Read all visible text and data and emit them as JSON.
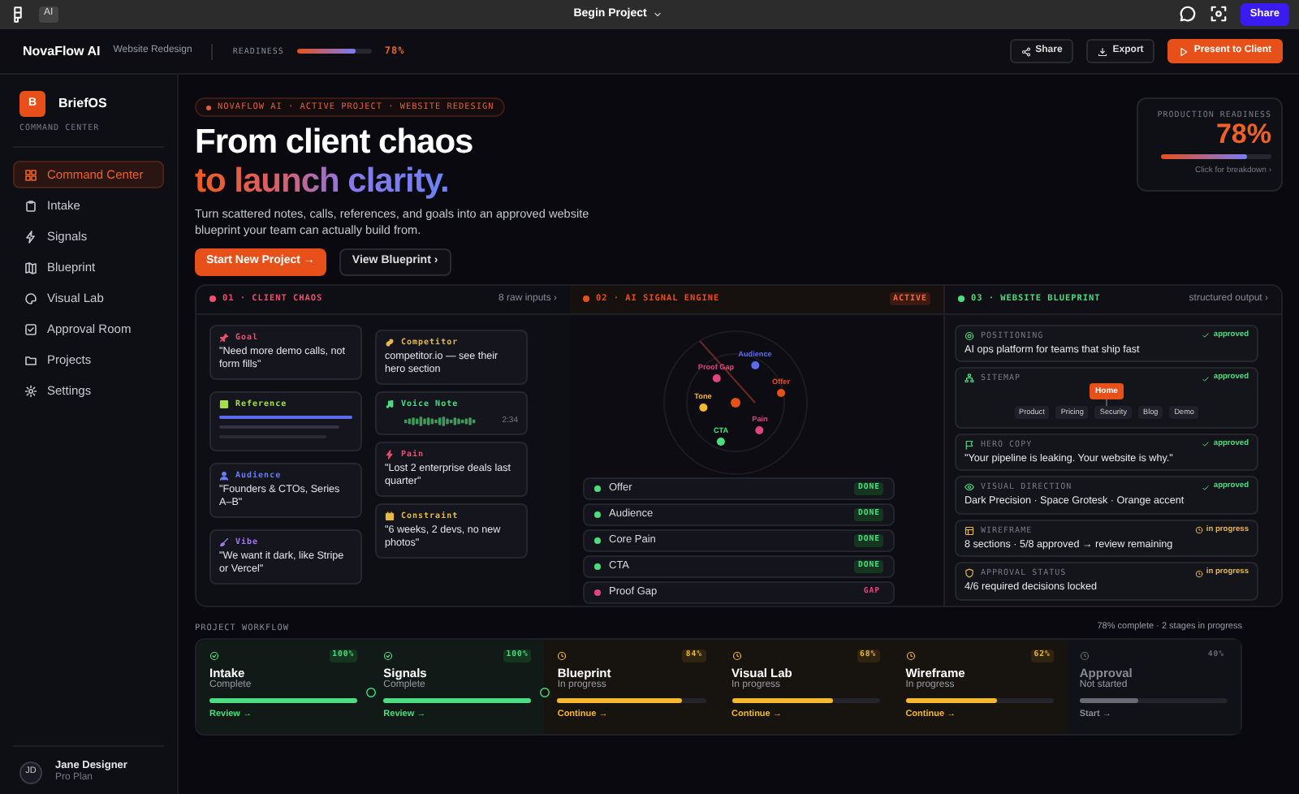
{
  "app_bar": {
    "badge": "AI",
    "file_title": "Begin Project",
    "share_button": "Share"
  },
  "header": {
    "brand": "NovaFlow AI",
    "project": "Website Redesign",
    "readiness_label": "READINESS",
    "readiness": {
      "level": 0.78,
      "reading": "78%"
    },
    "actions": [
      {
        "label": "Share",
        "kind": "share"
      },
      {
        "label": "Export",
        "kind": "export"
      },
      {
        "label": "Present to Client",
        "kind": "present"
      }
    ]
  },
  "sidebar": {
    "logo_letter": "B",
    "brand": "BriefOS",
    "subtitle": "COMMAND CENTER",
    "items": [
      {
        "label": "Command Center",
        "selected": true
      },
      {
        "label": "Intake",
        "selected": false
      },
      {
        "label": "Signals",
        "selected": false
      },
      {
        "label": "Blueprint",
        "selected": false
      },
      {
        "label": "Visual Lab",
        "selected": false
      },
      {
        "label": "Approval Room",
        "selected": false
      },
      {
        "label": "Projects",
        "selected": false
      },
      {
        "label": "Settings",
        "selected": false
      }
    ],
    "user": {
      "initials": "JD",
      "name": "Jane Designer",
      "plan": "Pro Plan"
    }
  },
  "hero": {
    "tag": "NOVAFLOW AI · ACTIVE PROJECT · WEBSITE REDESIGN",
    "headline_1": "From client chaos",
    "headline_2": "to launch clarity.",
    "lead": "Turn scattered notes, calls, references, and goals into an approved website blueprint your team can actually build from.",
    "primary_button": "Start New Project →",
    "secondary_button": "View Blueprint ›"
  },
  "readiness_card": {
    "label": "PRODUCTION READINESS",
    "value": "78%",
    "level": 0.78,
    "link": "Click for breakdown ›"
  },
  "client_chaos": {
    "title": "01 · CLIENT CHAOS",
    "count": "8 raw inputs ›",
    "columns": [
      {
        "cards": [
          {
            "kind": "text",
            "label": "Goal",
            "color": "#ef4f6e",
            "text": "\"Need more demo calls, not form fills\""
          },
          {
            "kind": "reference",
            "label": "Reference",
            "color": "#a3e04a"
          },
          {
            "kind": "text",
            "label": "Audience",
            "color": "#6b7cf5",
            "text": "\"Founders & CTOs, Series A–B\""
          },
          {
            "kind": "text",
            "label": "Vibe",
            "color": "#a678f0",
            "text": "\"We want it dark, like Stripe or Vercel\""
          }
        ]
      },
      {
        "cards": [
          {
            "kind": "text",
            "label": "Competitor",
            "color": "#e8b84a",
            "text": "competitor.io — see their hero section"
          },
          {
            "kind": "voice",
            "label": "Voice Note",
            "color": "#4ade80",
            "duration": "2:34"
          },
          {
            "kind": "text",
            "label": "Pain",
            "color": "#ef4f6e",
            "text": "\"Lost 2 enterprise deals last quarter\""
          },
          {
            "kind": "text",
            "label": "Constraint",
            "color": "#e8b84a",
            "text": "\"6 weeks, 2 devs, no new photos\""
          }
        ]
      }
    ]
  },
  "signal_engine": {
    "title": "02 · AI SIGNAL ENGINE",
    "status": "ACTIVE",
    "nodes": [
      {
        "label": "Audience",
        "color": "#5b6cf0"
      },
      {
        "label": "Proof Gap",
        "color": "#e0457b"
      },
      {
        "label": "Offer",
        "color": "#e8501a"
      },
      {
        "label": "Tone",
        "color": "#f5b82e"
      },
      {
        "label": "Pain",
        "color": "#e0457b"
      },
      {
        "label": "CTA",
        "color": "#4ade80"
      }
    ],
    "signals": [
      {
        "label": "Offer",
        "status": "DONE",
        "done": true
      },
      {
        "label": "Audience",
        "status": "DONE",
        "done": true
      },
      {
        "label": "Core Pain",
        "status": "DONE",
        "done": true
      },
      {
        "label": "CTA",
        "status": "DONE",
        "done": true
      },
      {
        "label": "Proof Gap",
        "status": "GAP",
        "done": false
      }
    ]
  },
  "blueprint": {
    "title": "03 · WEBSITE BLUEPRINT",
    "subtitle": "structured output ›",
    "items": [
      {
        "kind": "text",
        "label": "POSITIONING",
        "approved": true,
        "status": "approved",
        "text": "AI ops platform for teams that ship fast"
      },
      {
        "kind": "sitemap",
        "label": "SITEMAP",
        "approved": true,
        "status": "approved",
        "root": "Home",
        "pages": [
          "Product",
          "Pricing",
          "Security",
          "Blog",
          "Demo"
        ]
      },
      {
        "kind": "text",
        "label": "HERO COPY",
        "approved": true,
        "status": "approved",
        "text": "\"Your pipeline is leaking. Your website is why.\""
      },
      {
        "kind": "text",
        "label": "VISUAL DIRECTION",
        "approved": true,
        "status": "approved",
        "text": "Dark Precision · Space Grotesk · Orange accent"
      },
      {
        "kind": "text",
        "label": "WIREFRAME",
        "approved": false,
        "status": "in progress",
        "text": "8 sections · 5/8 approved → review remaining"
      },
      {
        "kind": "text",
        "label": "APPROVAL STATUS",
        "approved": false,
        "status": "in progress",
        "text": "4/6 required decisions locked"
      }
    ]
  },
  "workflow": {
    "title": "PROJECT WORKFLOW",
    "summary": "78% complete · 2 stages in progress",
    "stages": [
      {
        "kind": "complete",
        "name": "Intake",
        "percent": "100%",
        "status": "Complete",
        "level": 1,
        "action": "Review →"
      },
      {
        "kind": "complete",
        "name": "Signals",
        "percent": "100%",
        "status": "Complete",
        "level": 1,
        "action": "Review →"
      },
      {
        "kind": "active",
        "name": "Blueprint",
        "percent": "84%",
        "status": "In progress",
        "level": 0.84,
        "action": "Continue →"
      },
      {
        "kind": "active",
        "name": "Visual Lab",
        "percent": "68%",
        "status": "In progress",
        "level": 0.68,
        "action": "Continue →"
      },
      {
        "kind": "active",
        "name": "Wireframe",
        "percent": "62%",
        "status": "In progress",
        "level": 0.62,
        "action": "Continue →"
      },
      {
        "kind": "pending",
        "name": "Approval",
        "percent": "40%",
        "status": "Not started",
        "level": 0.4,
        "action": "Start →"
      }
    ]
  }
}
